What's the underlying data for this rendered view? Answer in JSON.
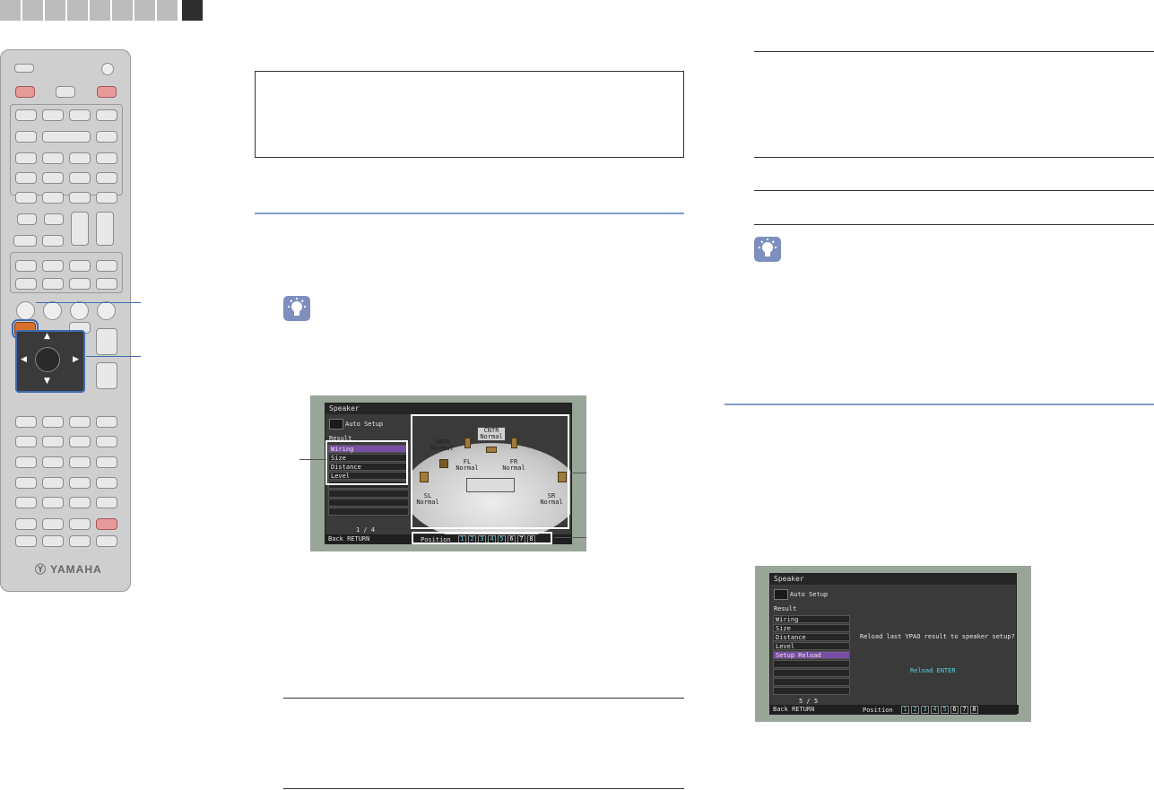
{
  "tabs": {
    "count": 9,
    "active_index": 8
  },
  "remote": {
    "brand": "Ⓨ YAMAHA"
  },
  "speaker_screen_1": {
    "title": "Speaker",
    "menu_label": "Auto Setup",
    "result_label": "Result",
    "items": [
      "Wiring",
      "Size",
      "Distance",
      "Level"
    ],
    "page": "1 / 4",
    "back": "Back RETURN",
    "position_label": "Position",
    "positions": [
      "1",
      "2",
      "3",
      "4",
      "5",
      "6",
      "7",
      "8"
    ],
    "speakers": {
      "swfr": "SWFR",
      "swfr_state": "Normal",
      "cntr": "CNTR",
      "cntr_state": "Normal",
      "fl": "FL",
      "fl_state": "Normal",
      "fr": "FR",
      "fr_state": "Normal",
      "sl": "SL",
      "sl_state": "Normal",
      "sr": "SR",
      "sr_state": "Normal"
    }
  },
  "speaker_screen_2": {
    "title": "Speaker",
    "menu_label": "Auto Setup",
    "result_label": "Result",
    "items": [
      "Wiring",
      "Size",
      "Distance",
      "Level",
      "Setup Reload"
    ],
    "page": "5 / 5",
    "back": "Back RETURN",
    "message": "Reload last YPAO result to speaker setup?",
    "reload": "Reload ENTER",
    "position_label": "Position",
    "positions": [
      "1",
      "2",
      "3",
      "4",
      "5",
      "6",
      "7",
      "8"
    ]
  },
  "colors": {
    "accent_blue": "#7f9ccc",
    "selected_row": "#7a4da6",
    "highlight_button": "#d8702c"
  }
}
